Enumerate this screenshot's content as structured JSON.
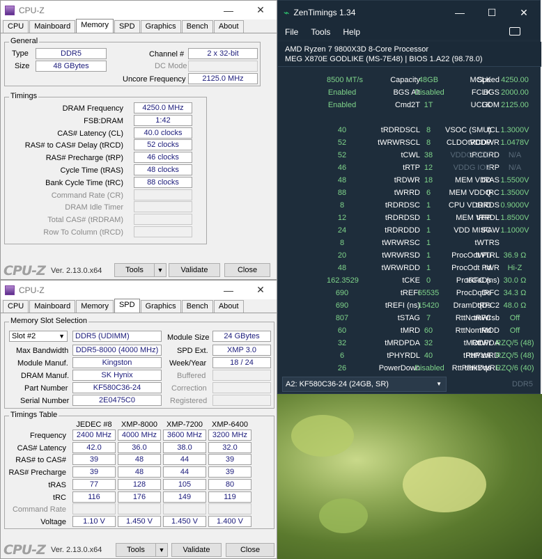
{
  "cpuz1": {
    "title": "CPU-Z",
    "tabs": [
      "CPU",
      "Mainboard",
      "Memory",
      "SPD",
      "Graphics",
      "Bench",
      "About"
    ],
    "general": {
      "label": "General",
      "type_label": "Type",
      "type": "DDR5",
      "size_label": "Size",
      "size": "48 GBytes",
      "channel_label": "Channel #",
      "channel": "2 x 32-bit",
      "dcmode_label": "DC Mode",
      "uncore_label": "Uncore Frequency",
      "uncore": "2125.0 MHz"
    },
    "timings": {
      "label": "Timings",
      "rows": [
        {
          "l": "DRAM Frequency",
          "v": "4250.0 MHz"
        },
        {
          "l": "FSB:DRAM",
          "v": "1:42"
        },
        {
          "l": "CAS# Latency (CL)",
          "v": "40.0 clocks"
        },
        {
          "l": "RAS# to CAS# Delay (tRCD)",
          "v": "52 clocks"
        },
        {
          "l": "RAS# Precharge (tRP)",
          "v": "46 clocks"
        },
        {
          "l": "Cycle Time (tRAS)",
          "v": "48 clocks"
        },
        {
          "l": "Bank Cycle Time (tRC)",
          "v": "88 clocks"
        },
        {
          "l": "Command Rate (CR)",
          "v": ""
        },
        {
          "l": "DRAM Idle Timer",
          "v": ""
        },
        {
          "l": "Total CAS# (tRDRAM)",
          "v": ""
        },
        {
          "l": "Row To Column (tRCD)",
          "v": ""
        }
      ]
    },
    "logo": "CPU-Z",
    "version": "Ver. 2.13.0.x64",
    "tools": "Tools",
    "validate": "Validate",
    "close": "Close"
  },
  "cpuz2": {
    "title": "CPU-Z",
    "tabs": [
      "CPU",
      "Mainboard",
      "Memory",
      "SPD",
      "Graphics",
      "Bench",
      "About"
    ],
    "slot_group": "Memory Slot Selection",
    "slot": "Slot #2",
    "slot_type": "DDR5 (UDIMM)",
    "module_size_label": "Module Size",
    "module_size": "24 GBytes",
    "max_bw_label": "Max Bandwidth",
    "max_bw": "DDR5-8000 (4000 MHz)",
    "spd_ext_label": "SPD Ext.",
    "spd_ext": "XMP 3.0",
    "manuf_label": "Module Manuf.",
    "manuf": "Kingston",
    "week_label": "Week/Year",
    "week": "18 / 24",
    "dram_manuf_label": "DRAM Manuf.",
    "dram_manuf": "SK Hynix",
    "buffered_label": "Buffered",
    "part_label": "Part Number",
    "part": "KF580C36-24",
    "correction_label": "Correction",
    "serial_label": "Serial Number",
    "serial": "2E0475C0",
    "registered_label": "Registered",
    "table_label": "Timings Table",
    "columns": [
      "JEDEC #8",
      "XMP-8000",
      "XMP-7200",
      "XMP-6400"
    ],
    "rows": [
      {
        "l": "Frequency",
        "v": [
          "2400 MHz",
          "4000 MHz",
          "3600 MHz",
          "3200 MHz"
        ]
      },
      {
        "l": "CAS# Latency",
        "v": [
          "42.0",
          "36.0",
          "38.0",
          "32.0"
        ]
      },
      {
        "l": "RAS# to CAS#",
        "v": [
          "39",
          "48",
          "44",
          "39"
        ]
      },
      {
        "l": "RAS# Precharge",
        "v": [
          "39",
          "48",
          "44",
          "39"
        ]
      },
      {
        "l": "tRAS",
        "v": [
          "77",
          "128",
          "105",
          "80"
        ]
      },
      {
        "l": "tRC",
        "v": [
          "116",
          "176",
          "149",
          "119"
        ]
      },
      {
        "l": "Command Rate",
        "v": [
          "",
          "",
          "",
          ""
        ]
      },
      {
        "l": "Voltage",
        "v": [
          "1.10 V",
          "1.450 V",
          "1.450 V",
          "1.400 V"
        ]
      }
    ],
    "logo": "CPU-Z",
    "version": "Ver. 2.13.0.x64",
    "tools": "Tools",
    "validate": "Validate",
    "close": "Close"
  },
  "zen": {
    "title": "ZenTimings 1.34",
    "menu": [
      "File",
      "Tools",
      "Help"
    ],
    "cpu": "AMD Ryzen 7 9800X3D 8-Core Processor",
    "board": "MEG X870E GODLIKE (MS-7E48) | BIOS 1.A22 (98.78.0)",
    "rows": [
      [
        [
          "Speed",
          "8500 MT/s"
        ],
        [
          "Capacity",
          "48GB"
        ],
        [
          "MCLK",
          "4250.00"
        ]
      ],
      [
        [
          "BGS",
          "Enabled"
        ],
        [
          "BGS Alt",
          "Disabled"
        ],
        [
          "FCLK",
          "2000.00"
        ]
      ],
      [
        [
          "GDM",
          "Enabled"
        ],
        [
          "Cmd2T",
          "1T"
        ],
        [
          "UCLK",
          "2125.00"
        ]
      ],
      null,
      [
        [
          "tCL",
          "40"
        ],
        [
          "tRDRDSCL",
          "8"
        ],
        [
          "VSOC (SMU)",
          "1.3000V"
        ]
      ],
      [
        [
          "tRCDWR",
          "52"
        ],
        [
          "tWRWRSCL",
          "8"
        ],
        [
          "CLDO VDDP",
          "1.0478V"
        ]
      ],
      [
        [
          "tRCDRD",
          "52"
        ],
        [
          "tCWL",
          "38"
        ],
        [
          "VDDG CCD",
          "N/A"
        ]
      ],
      [
        [
          "tRP",
          "46"
        ],
        [
          "tRTP",
          "12"
        ],
        [
          "VDDG IOD",
          "N/A"
        ]
      ],
      [
        [
          "tRAS",
          "48"
        ],
        [
          "tRDWR",
          "18"
        ],
        [
          "MEM VDD",
          "1.5500V"
        ]
      ],
      [
        [
          "tRC",
          "88"
        ],
        [
          "tWRRD",
          "6"
        ],
        [
          "MEM VDDQ",
          "1.3500V"
        ]
      ],
      [
        [
          "tRRDS",
          "8"
        ],
        [
          "tRDRDSC",
          "1"
        ],
        [
          "CPU VDDIO",
          "0.9000V"
        ]
      ],
      [
        [
          "tRRDL",
          "12"
        ],
        [
          "tRDRDSD",
          "1"
        ],
        [
          "MEM VPP",
          "1.8500V"
        ]
      ],
      [
        [
          "tFAW",
          "24"
        ],
        [
          "tRDRDDD",
          "1"
        ],
        [
          "VDD MISC",
          "1.1000V"
        ]
      ],
      [
        [
          "tWTRS",
          "8"
        ],
        [
          "tWRWRSC",
          "1"
        ],
        null
      ],
      [
        [
          "tWTRL",
          "20"
        ],
        [
          "tWRWRSD",
          "1"
        ],
        [
          "ProcOdt Pu",
          "36.9 Ω"
        ]
      ],
      [
        [
          "tWR",
          "48"
        ],
        [
          "tWRWRDD",
          "1"
        ],
        [
          "ProcOdt Pd",
          "Hi-Z"
        ]
      ],
      [
        [
          "tRFC (ns)",
          "162.3529"
        ],
        [
          "tCKE",
          "0"
        ],
        [
          "ProcCaDs",
          "30.0 Ω"
        ]
      ],
      [
        [
          "tRFC",
          "690"
        ],
        [
          "tREFI",
          "65535"
        ],
        [
          "ProcDqDs",
          "34.3 Ω"
        ]
      ],
      [
        [
          "tRFC2",
          "690"
        ],
        [
          "tREFI (ns)",
          "15420"
        ],
        [
          "DramDqDs",
          "48.0 Ω"
        ]
      ],
      [
        [
          "tRFCsb",
          "807"
        ],
        [
          "tSTAG",
          "7"
        ],
        [
          "RttNomWr",
          "Off"
        ]
      ],
      [
        [
          "tMOD",
          "60"
        ],
        [
          "tMRD",
          "60"
        ],
        [
          "RttNomRd",
          "Off"
        ]
      ],
      [
        [
          "tMODPDA",
          "32"
        ],
        [
          "tMRDPDA",
          "32"
        ],
        [
          "RttWr",
          "RZQ/5 (48)"
        ]
      ],
      [
        [
          "tPHYWRD",
          "6"
        ],
        [
          "tPHYRDL",
          "40"
        ],
        [
          "RttPark",
          "RZQ/5 (48)"
        ]
      ],
      [
        [
          "tPHYWRL",
          "26"
        ],
        [
          "PowerDown",
          "Disabled"
        ],
        [
          "RttParkDqs",
          "RZQ/6 (40)"
        ]
      ]
    ],
    "dimm": "A2: KF580C36-24 (24GB, SR)",
    "ddr": "DDR5",
    "colors": {
      "value": "#7fd48a",
      "bg": "#1e2d3b"
    }
  }
}
